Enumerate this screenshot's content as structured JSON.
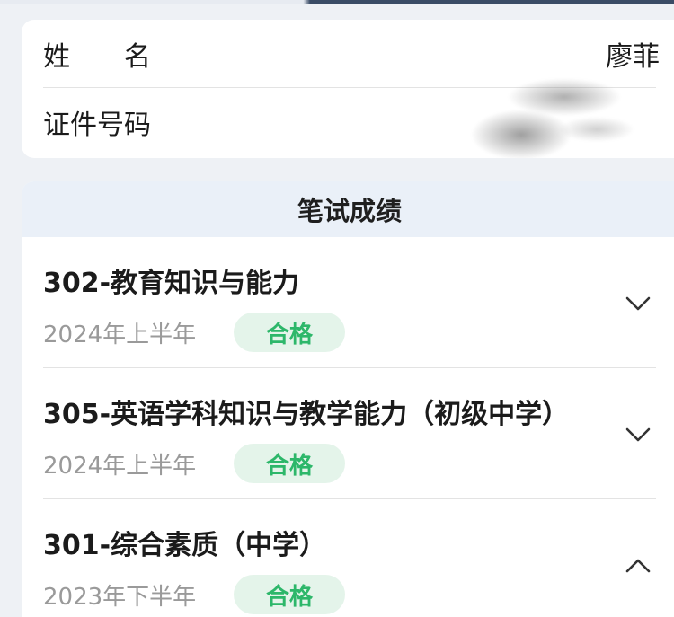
{
  "info": {
    "name_label": "姓      名",
    "name_label_parts": [
      "姓",
      "名"
    ],
    "name_value": "廖菲",
    "id_label": "证件号码"
  },
  "scores": {
    "header": "笔试成绩",
    "items": [
      {
        "subject": "302-教育知识与能力",
        "term": "2024年上半年",
        "status": "合格",
        "expanded": false
      },
      {
        "subject": "305-英语学科知识与教学能力（初级中学）",
        "term": "2024年上半年",
        "status": "合格",
        "expanded": false
      },
      {
        "subject": "301-综合素质（中学）",
        "term": "2023年下半年",
        "status": "合格",
        "expanded": true
      }
    ]
  },
  "colors": {
    "pass_text": "#2db76a",
    "pass_bg": "#e4f4ea",
    "header_bg": "#eaf0f8",
    "page_bg": "#eef1f5"
  },
  "icons": {
    "collapsed": "chevron-down-icon",
    "expanded": "chevron-up-icon"
  }
}
